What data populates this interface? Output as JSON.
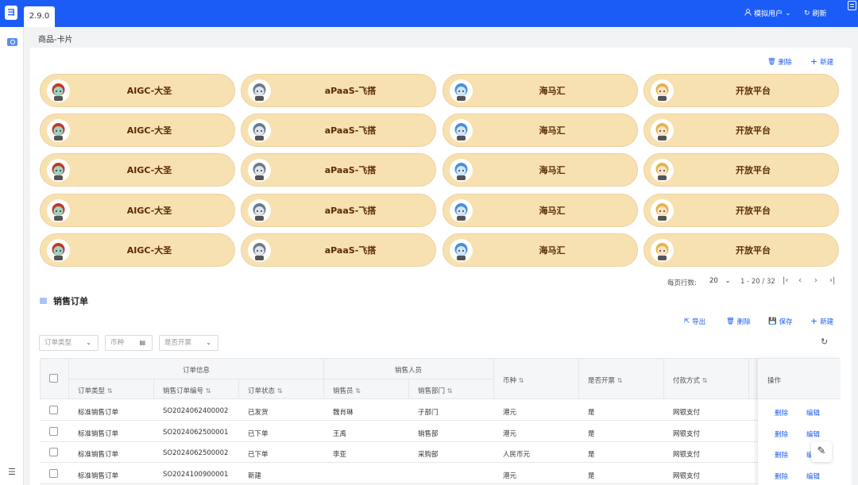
{
  "app": {
    "version": "2.9.0",
    "user_label": "模拟用户",
    "refresh_label": "刷新"
  },
  "breadcrumb": "商品-卡片",
  "cards_toolbar": {
    "delete_label": "删除",
    "new_label": "新建"
  },
  "cards": {
    "columns": [
      "AIGC-大圣",
      "aPaaS-飞搭",
      "海马汇",
      "开放平台"
    ],
    "row_count": 5
  },
  "pagination": {
    "rows_per_page_label": "每页行数:",
    "rows_per_page": "20",
    "range_text": "1 - 20 / 32"
  },
  "orders": {
    "title": "销售订单",
    "toolbar": {
      "export_label": "导出",
      "delete_label": "删除",
      "save_label": "保存",
      "new_label": "新建"
    },
    "filters": {
      "order_type": "订单类型",
      "currency": "币种",
      "invoiced": "是否开票"
    },
    "groups": {
      "order_info": "订单信息",
      "sales_person": "销售人员"
    },
    "headers": {
      "order_type": "订单类型",
      "order_no": "销售订单编号",
      "status": "订单状态",
      "seller": "销售员",
      "dept": "销售部门",
      "currency": "币种",
      "invoiced": "是否开票",
      "payment": "付款方式",
      "actions": "操作"
    },
    "rows": [
      {
        "type": "标准销售订单",
        "no": "SO2024062400002",
        "status": "已发货",
        "seller": "魏肖琳",
        "dept": "子部门",
        "currency": "港元",
        "invoiced": "是",
        "payment": "网银支付",
        "del": "删除",
        "edit": "编辑"
      },
      {
        "type": "标准销售订单",
        "no": "SO2024062500001",
        "status": "已下单",
        "seller": "王禹",
        "dept": "销售部",
        "currency": "港元",
        "invoiced": "是",
        "payment": "网银支付",
        "del": "删除",
        "edit": "编辑"
      },
      {
        "type": "标准销售订单",
        "no": "SO2024062500002",
        "status": "已下单",
        "seller": "李亚",
        "dept": "采购部",
        "currency": "人民币元",
        "invoiced": "是",
        "payment": "网银支付",
        "del": "删除",
        "edit": "编辑"
      },
      {
        "type": "标准销售订单",
        "no": "SO2024100900001",
        "status": "新建",
        "seller": "",
        "dept": "",
        "currency": "港元",
        "invoiced": "是",
        "payment": "网银支付",
        "del": "删除",
        "edit": "编辑"
      }
    ]
  },
  "colors": {
    "primary": "#1a5cf5",
    "card_bg": "#f8e1b0",
    "card_text": "#5a2a06"
  }
}
